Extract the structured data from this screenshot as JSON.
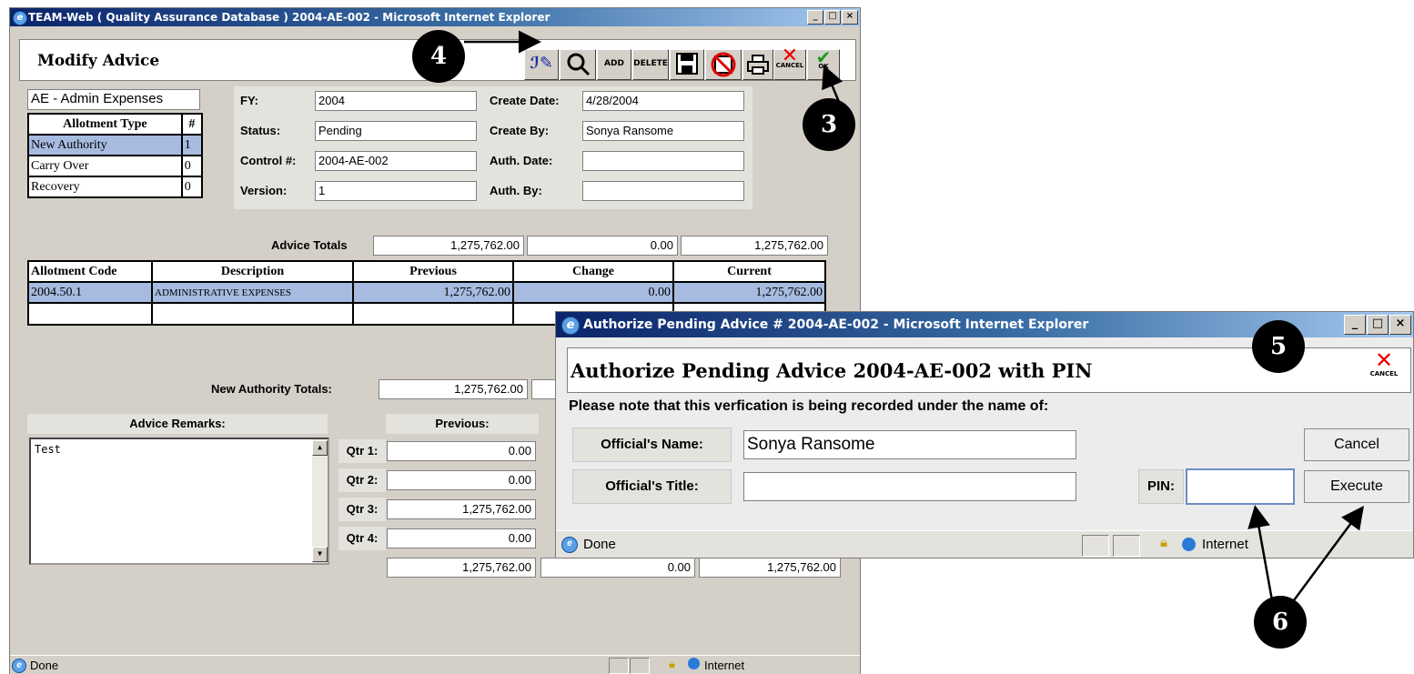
{
  "main_window": {
    "title": "TEAM-Web ( Quality Assurance Database ) 2004-AE-002 - Microsoft Internet Explorer",
    "heading": "Modify Advice",
    "toolbar": [
      "ADD",
      "DELETE",
      "CANCEL",
      "OK"
    ],
    "category": "AE - Admin Expenses",
    "allotment_types": {
      "headers": [
        "Allotment Type",
        "#"
      ],
      "rows": [
        [
          "New Authority",
          "1"
        ],
        [
          "Carry Over",
          "0"
        ],
        [
          "Recovery",
          "0"
        ]
      ]
    },
    "fields": {
      "fy_label": "FY:",
      "fy": "2004",
      "status_label": "Status:",
      "status": "Pending",
      "control_label": "Control #:",
      "control": "2004-AE-002",
      "version_label": "Version:",
      "version": "1",
      "create_date_label": "Create Date:",
      "create_date": "4/28/2004",
      "create_by_label": "Create By:",
      "create_by": "Sonya Ransome",
      "auth_date_label": "Auth. Date:",
      "auth_date": "",
      "auth_by_label": "Auth. By:",
      "auth_by": ""
    },
    "advice_totals": {
      "label": "Advice Totals",
      "previous": "1,275,762.00",
      "change": "0.00",
      "current": "1,275,762.00"
    },
    "allotment_table": {
      "headers": [
        "Allotment Code",
        "Description",
        "Previous",
        "Change",
        "Current"
      ],
      "rows": [
        [
          "2004.50.1",
          "ADMINISTRATIVE EXPENSES",
          "1,275,762.00",
          "0.00",
          "1,275,762.00"
        ]
      ]
    },
    "new_authority_totals": {
      "label": "New Authority Totals:",
      "previous": "1,275,762.00"
    },
    "remarks": {
      "label": "Advice Remarks:",
      "text": "Test"
    },
    "quarters": {
      "previous_label": "Previous:",
      "rows": [
        {
          "label": "Qtr 1:",
          "previous": "0.00"
        },
        {
          "label": "Qtr 2:",
          "previous": "0.00"
        },
        {
          "label": "Qtr 3:",
          "previous": "1,275,762.00"
        },
        {
          "label": "Qtr 4:",
          "previous": "0.00"
        }
      ],
      "totals": {
        "previous": "1,275,762.00",
        "change": "0.00",
        "current": "1,275,762.00"
      }
    },
    "status_bar": {
      "text": "Done",
      "zone": "Internet"
    }
  },
  "dialog": {
    "title": "Authorize Pending Advice # 2004-AE-002 - Microsoft Internet Explorer",
    "heading": "Authorize Pending Advice 2004-AE-002 with PIN",
    "cancel_icon_label": "CANCEL",
    "note": "Please note that this verfication is being recorded under the name of:",
    "name_label": "Official's Name:",
    "name": "Sonya Ransome",
    "title_label": "Official's Title:",
    "official_title": "",
    "pin_label": "PIN:",
    "pin": "",
    "cancel_button": "Cancel",
    "execute_button": "Execute",
    "status_bar": {
      "text": "Done",
      "zone": "Internet"
    }
  },
  "callouts": [
    "4",
    "3",
    "5",
    "6"
  ]
}
